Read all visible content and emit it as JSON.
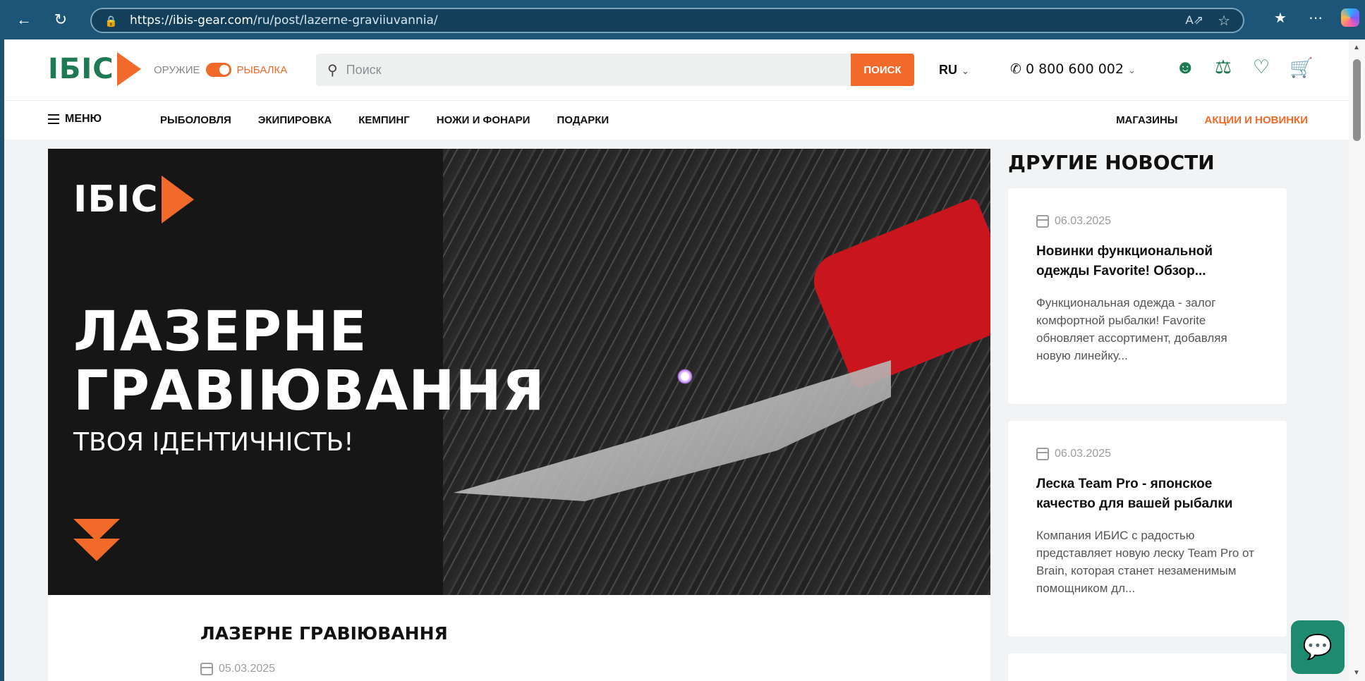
{
  "browser": {
    "url_host": "https://ibis-gear.com",
    "url_path": "/ru/post/lazerne-graviiuvannia/"
  },
  "header": {
    "logo_text": "ІБІС",
    "toggle_left": "ОРУЖИЕ",
    "toggle_right": "РЫБАЛКА",
    "search_placeholder": "Поиск",
    "search_button": "ПОИСК",
    "lang": "RU",
    "phone": "0 800 600 002"
  },
  "nav": {
    "menu": "МЕНЮ",
    "links": [
      "РЫБОЛОВЛЯ",
      "ЭКИПИРОВКА",
      "КЕМПИНГ",
      "НОЖИ И ФОНАРИ",
      "ПОДАРКИ"
    ],
    "right": [
      "МАГАЗИНЫ",
      "АКЦИИ И НОВИНКИ"
    ]
  },
  "hero": {
    "logo_text": "ІБІС",
    "title_line1": "ЛАЗЕРНЕ",
    "title_line2": "ГРАВІЮВАННЯ",
    "subtitle": "ТВОЯ ІДЕНТИЧНІСТЬ!"
  },
  "article": {
    "title": "ЛАЗЕРНЕ ГРАВІЮВАННЯ",
    "date": "05.03.2025"
  },
  "sidebar": {
    "title": "ДРУГИЕ НОВОСТИ",
    "news": [
      {
        "date": "06.03.2025",
        "title": "Новинки функциональной одежды Favorite! Обзор...",
        "text": "  Функциональная одежда - залог комфортной рыбалки! Favorite обновляет ассортимент, добавляя новую линейку..."
      },
      {
        "date": "06.03.2025",
        "title": "Леска Team Pro - японское качество для вашей рыбалки",
        "text": "Компания ИБИС с радостью представляет новую леску Team Pro от Brain, которая станет незаменимым помощником дл..."
      }
    ]
  },
  "colors": {
    "brand_green": "#1e7a55",
    "accent_orange": "#f26a2a"
  }
}
